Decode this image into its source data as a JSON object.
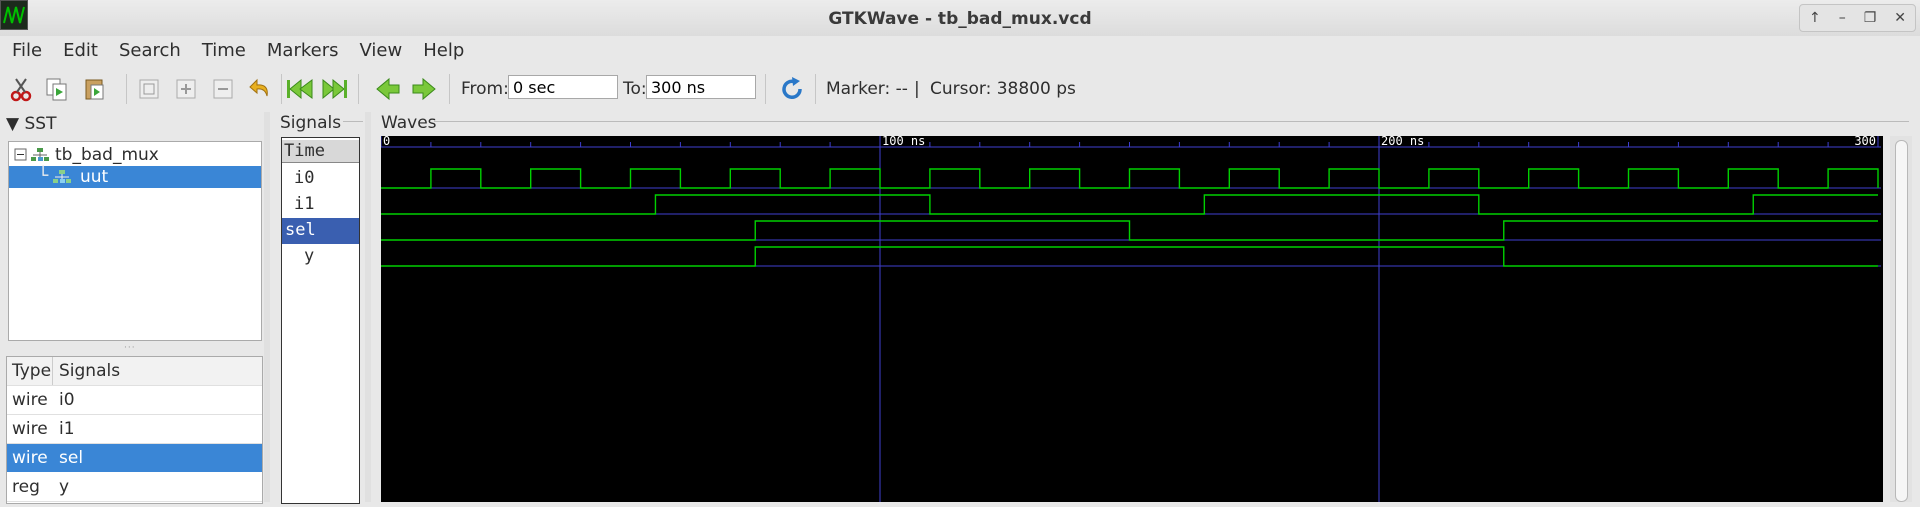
{
  "window": {
    "title": "GTKWave - tb_bad_mux.vcd",
    "buttons": [
      "↑",
      "–",
      "❐",
      "✕"
    ]
  },
  "menu": [
    "File",
    "Edit",
    "Search",
    "Time",
    "Markers",
    "View",
    "Help"
  ],
  "toolbar": {
    "from_label": "From:",
    "from_value": "0 sec",
    "to_label": "To:",
    "to_value": "300 ns",
    "marker_text": "Marker: --",
    "separator": "|",
    "cursor_text": "Cursor: 38800 ps",
    "icons": [
      "cut-icon",
      "copy-icon",
      "paste-icon",
      "zoom-fit-icon",
      "zoom-in-icon",
      "zoom-out-icon",
      "undo-icon",
      "first-icon",
      "last-icon",
      "back-icon",
      "forward-icon",
      "reload-icon"
    ]
  },
  "sst": {
    "header": "SST",
    "tree": [
      {
        "label": "tb_bad_mux",
        "selected": false
      },
      {
        "label": "uut",
        "selected": true
      }
    ]
  },
  "signals_table": {
    "headers": [
      "Type",
      "Signals"
    ],
    "rows": [
      {
        "type": "wire",
        "name": "i0",
        "selected": false
      },
      {
        "type": "wire",
        "name": "i1",
        "selected": false
      },
      {
        "type": "wire",
        "name": "sel",
        "selected": true
      },
      {
        "type": "reg",
        "name": "y",
        "selected": false
      }
    ]
  },
  "signals_pane": {
    "label": "Signals",
    "rows": [
      {
        "name": "Time",
        "selected": false
      },
      {
        "name": "i0",
        "selected": false
      },
      {
        "name": "i1",
        "selected": false
      },
      {
        "name": "sel",
        "selected": true
      },
      {
        "name": "y",
        "selected": false
      }
    ]
  },
  "waves": {
    "label": "Waves",
    "time_range_ns": [
      0,
      300
    ],
    "timeline_labels": [
      {
        "t": 0,
        "text": "0"
      },
      {
        "t": 100,
        "text": "100 ns"
      },
      {
        "t": 200,
        "text": "200 ns"
      },
      {
        "t": 300,
        "text": "300"
      }
    ],
    "wave_color": "#00d000",
    "grid_color": "#3f3fd0",
    "traces": [
      {
        "name": "i0",
        "initial": 0,
        "transitions_ns": [
          10,
          20,
          30,
          40,
          50,
          60,
          70,
          80,
          90,
          100,
          110,
          120,
          130,
          140,
          150,
          160,
          170,
          180,
          190,
          200,
          210,
          220,
          230,
          240,
          250,
          260,
          270,
          280,
          290,
          300
        ]
      },
      {
        "name": "i1",
        "initial": 0,
        "transitions_ns": [
          55,
          110,
          165,
          220,
          275
        ]
      },
      {
        "name": "sel",
        "initial": 0,
        "transitions_ns": [
          75,
          150,
          225
        ]
      },
      {
        "name": "y",
        "initial": 0,
        "transitions_ns": [
          75,
          225
        ]
      }
    ]
  }
}
